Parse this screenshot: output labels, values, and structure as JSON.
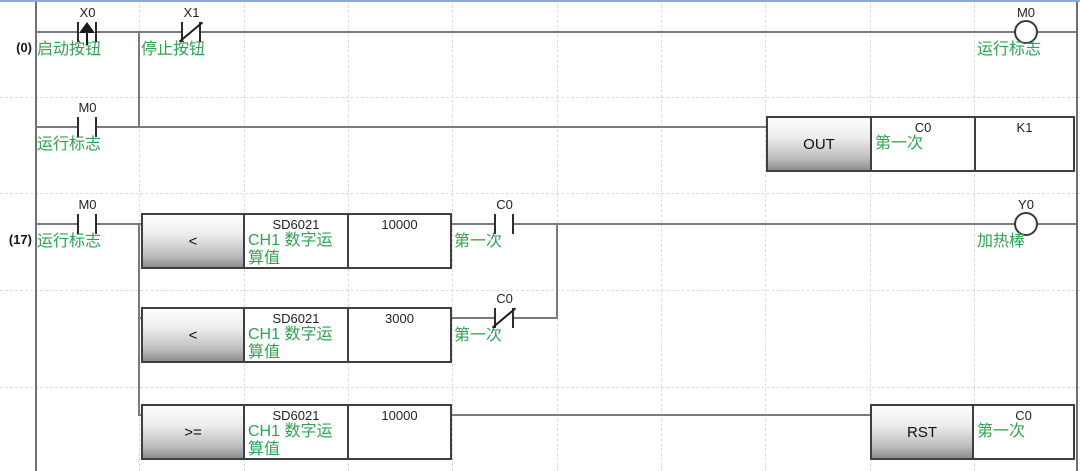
{
  "editor": {
    "top_border_color": "#8aabdc",
    "comment_color": "#2fa352",
    "wire_color": "#7b7b7b",
    "rungs": {
      "rung1": {
        "step_label": "(0)",
        "contact_x0": {
          "device": "X0",
          "comment": "启动按钮"
        },
        "contact_x1": {
          "device": "X1",
          "comment": "停止按钮"
        },
        "coil_m0": {
          "device": "M0",
          "comment": "运行标志"
        }
      },
      "rung2": {
        "contact_m0": {
          "device": "M0",
          "comment": "运行标志"
        },
        "out_block": {
          "mnemonic": "OUT",
          "operand_device": "C0",
          "operand_comment": "第一次",
          "count_value": "K1"
        }
      },
      "rung3": {
        "step_label": "(17)",
        "contact_m0": {
          "device": "M0",
          "comment": "运行标志"
        },
        "compare_block": {
          "operator": "<",
          "source_device": "SD6021",
          "source_comment": "CH1 数字运算值",
          "compare_value": "10000"
        },
        "contact_c0": {
          "device": "C0",
          "comment": "第一次"
        },
        "coil_y0": {
          "device": "Y0",
          "comment": "加热棒"
        }
      },
      "rung4": {
        "compare_block": {
          "operator": "<",
          "source_device": "SD6021",
          "source_comment": "CH1 数字运算值",
          "compare_value": "3000"
        },
        "contact_c0_nc": {
          "device": "C0",
          "comment": "第一次"
        }
      },
      "rung5": {
        "compare_block": {
          "operator": ">=",
          "source_device": "SD6021",
          "source_comment": "CH1 数字运算值",
          "compare_value": "10000"
        },
        "rst_block": {
          "mnemonic": "RST",
          "operand_device": "C0",
          "operand_comment": "第一次"
        }
      }
    }
  }
}
